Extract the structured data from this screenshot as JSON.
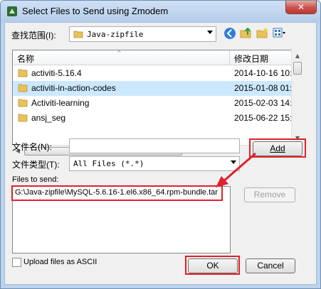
{
  "window": {
    "title": "Select Files to Send using Zmodem"
  },
  "lookin": {
    "label": "查找范围(I):",
    "value": "Java-zipfile"
  },
  "columns": {
    "name": "名称",
    "modified": "修改日期"
  },
  "files": [
    {
      "name": "activiti-5.16.4",
      "date": "2014-10-16 10:2"
    },
    {
      "name": "activiti-in-action-codes",
      "date": "2015-01-08 01:0"
    },
    {
      "name": "Activiti-learning",
      "date": "2015-02-03 14:4"
    },
    {
      "name": "ansj_seg",
      "date": "2015-06-22 15:3"
    }
  ],
  "filename": {
    "label": "文件名(N):",
    "value": ""
  },
  "filetype": {
    "label": "文件类型(T):",
    "value": "All Files (*.*)"
  },
  "buttons": {
    "add": "Add",
    "remove": "Remove",
    "ok": "OK",
    "cancel": "Cancel"
  },
  "send": {
    "label": "Files to send:",
    "items": [
      "G:\\Java-zipfile\\MySQL-5.6.16-1.el6.x86_64.rpm-bundle.tar"
    ]
  },
  "ascii": {
    "label": "Upload files as ASCII",
    "checked": false
  },
  "colors": {
    "highlight": "#e0202b",
    "selection": "#cce8ff",
    "folder": "#e8c25a"
  }
}
